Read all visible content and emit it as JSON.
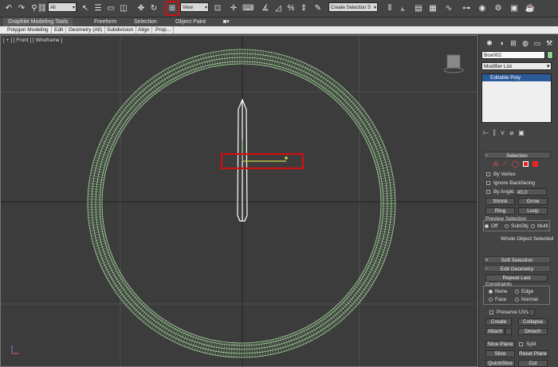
{
  "toolbar": {
    "selection_filter": "All",
    "ref_coord": "View",
    "named_selection": "Create Selection S"
  },
  "ribbon": {
    "tabs": [
      "Graphite Modeling Tools",
      "Freeform",
      "Selection",
      "Object Paint"
    ],
    "sub_tabs": [
      "Polygon Modeling",
      "Edit",
      "Geometry (All)",
      "Subdivision",
      "Align",
      "Prop..."
    ]
  },
  "viewport": {
    "label": "[ + ] [ Front ] [ Wireframe ]"
  },
  "panel": {
    "object_name": "Box002",
    "modifier_list": "Modifier List",
    "stack_item": "Editable Poly",
    "object_color": "#8fd18f",
    "selection": {
      "title": "Selection",
      "by_vertex": "By Vertex",
      "ignore_backfacing": "Ignore Backfacing",
      "by_angle": "By Angle:",
      "angle_value": "45,0",
      "shrink": "Shrink",
      "grow": "Grow",
      "ring": "Ring",
      "loop": "Loop",
      "preview_selection": "Preview Selection",
      "off": "Off",
      "subobj": "SubObj",
      "multi": "Multi",
      "status": "Whole Object Selected"
    },
    "soft_selection": "Soft Selection",
    "edit_geometry": {
      "title": "Edit Geometry",
      "repeat_last": "Repeat Last",
      "constraints": "Constraints",
      "none": "None",
      "edge": "Edge",
      "face": "Face",
      "normal": "Normal",
      "preserve_uvs": "Preserve UVs",
      "create": "Create",
      "collapse": "Collapse",
      "attach": "Attach",
      "detach": "Detach",
      "slice_plane": "Slice Plane",
      "split": "Split",
      "slice": "Slice",
      "reset_plane": "Reset Plane",
      "quickslice": "QuickSlice",
      "cut": "Cut"
    }
  },
  "colors": {
    "highlight": "#d01010",
    "wire": "#a8d8a0",
    "selected_wire": "#ffffff"
  }
}
